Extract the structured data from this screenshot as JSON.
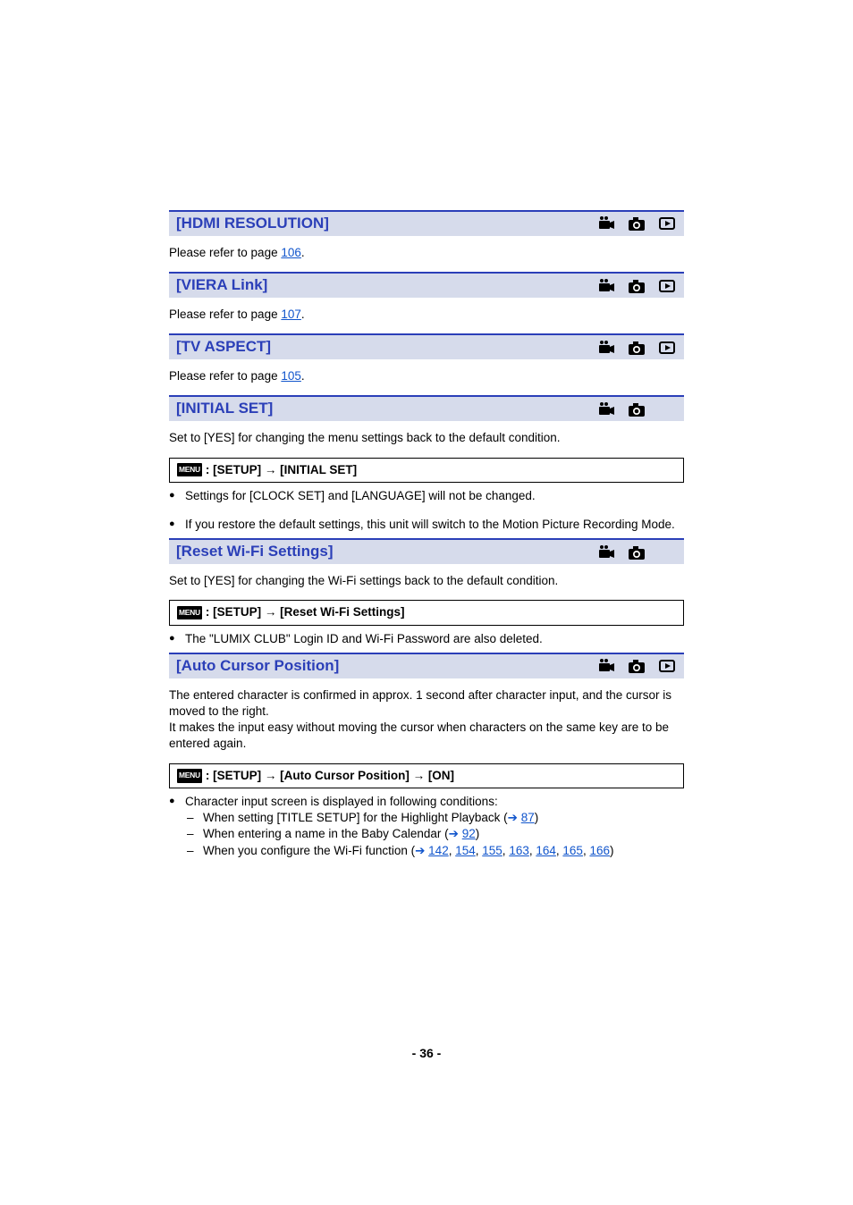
{
  "page_number": "- 36 -",
  "icons": {
    "video": "video-icon",
    "photo": "photo-icon",
    "play": "play-icon"
  },
  "sections": [
    {
      "id": "hdmi",
      "title": "[HDMI RESOLUTION]",
      "icons": [
        "video",
        "photo",
        "play"
      ],
      "refer_prefix": "Please refer to page ",
      "refer_link": "106",
      "refer_suffix": "."
    },
    {
      "id": "viera",
      "title": "[VIERA Link]",
      "icons": [
        "video",
        "photo",
        "play"
      ],
      "refer_prefix": "Please refer to page ",
      "refer_link": "107",
      "refer_suffix": "."
    },
    {
      "id": "tvaspect",
      "title": "[TV ASPECT]",
      "icons": [
        "video",
        "photo",
        "play"
      ],
      "refer_prefix": "Please refer to page ",
      "refer_link": "105",
      "refer_suffix": "."
    },
    {
      "id": "initial",
      "title": "[INITIAL SET]",
      "icons": [
        "video",
        "photo"
      ],
      "intro": "Set to [YES] for changing the menu settings back to the default condition.",
      "menu_label": "MENU",
      "menu_path": ": [SETUP] → [INITIAL SET]",
      "bullets": [
        "Settings for [CLOCK SET] and [LANGUAGE] will not be changed.",
        "If you restore the default settings, this unit will switch to the Motion Picture Recording Mode."
      ]
    },
    {
      "id": "resetwifi",
      "title": "[Reset Wi-Fi Settings]",
      "icons": [
        "video",
        "photo"
      ],
      "intro": "Set to [YES] for changing the Wi-Fi settings back to the default condition.",
      "menu_label": "MENU",
      "menu_path": ": [SETUP] → [Reset Wi-Fi Settings]",
      "bullets": [
        "The \"LUMIX CLUB\" Login ID and Wi-Fi Password are also deleted."
      ]
    },
    {
      "id": "autocursor",
      "title": "[Auto Cursor Position]",
      "icons": [
        "video",
        "photo",
        "play"
      ],
      "intro": "The entered character is confirmed in approx. 1 second after character input, and the cursor is moved to the right.\nIt makes the input easy without moving the cursor when characters on the same key are to be entered again.",
      "menu_label": "MENU",
      "menu_path": ": [SETUP] → [Auto Cursor Position] → [ON]",
      "bullets_rich": {
        "lead": "Character input screen is displayed in following conditions:",
        "items": [
          {
            "pre": "When setting [TITLE SETUP] for the Highlight Playback (",
            "arrow": "➔ ",
            "links": [
              "87"
            ],
            "post": ")"
          },
          {
            "pre": "When entering a name in the Baby Calendar (",
            "arrow": "➔ ",
            "links": [
              "92"
            ],
            "post": ")"
          },
          {
            "pre": "When you configure the Wi-Fi function (",
            "arrow": "➔ ",
            "links": [
              "142",
              "154",
              "155",
              "163",
              "164",
              "165",
              "166"
            ],
            "post": ")"
          }
        ]
      }
    }
  ]
}
